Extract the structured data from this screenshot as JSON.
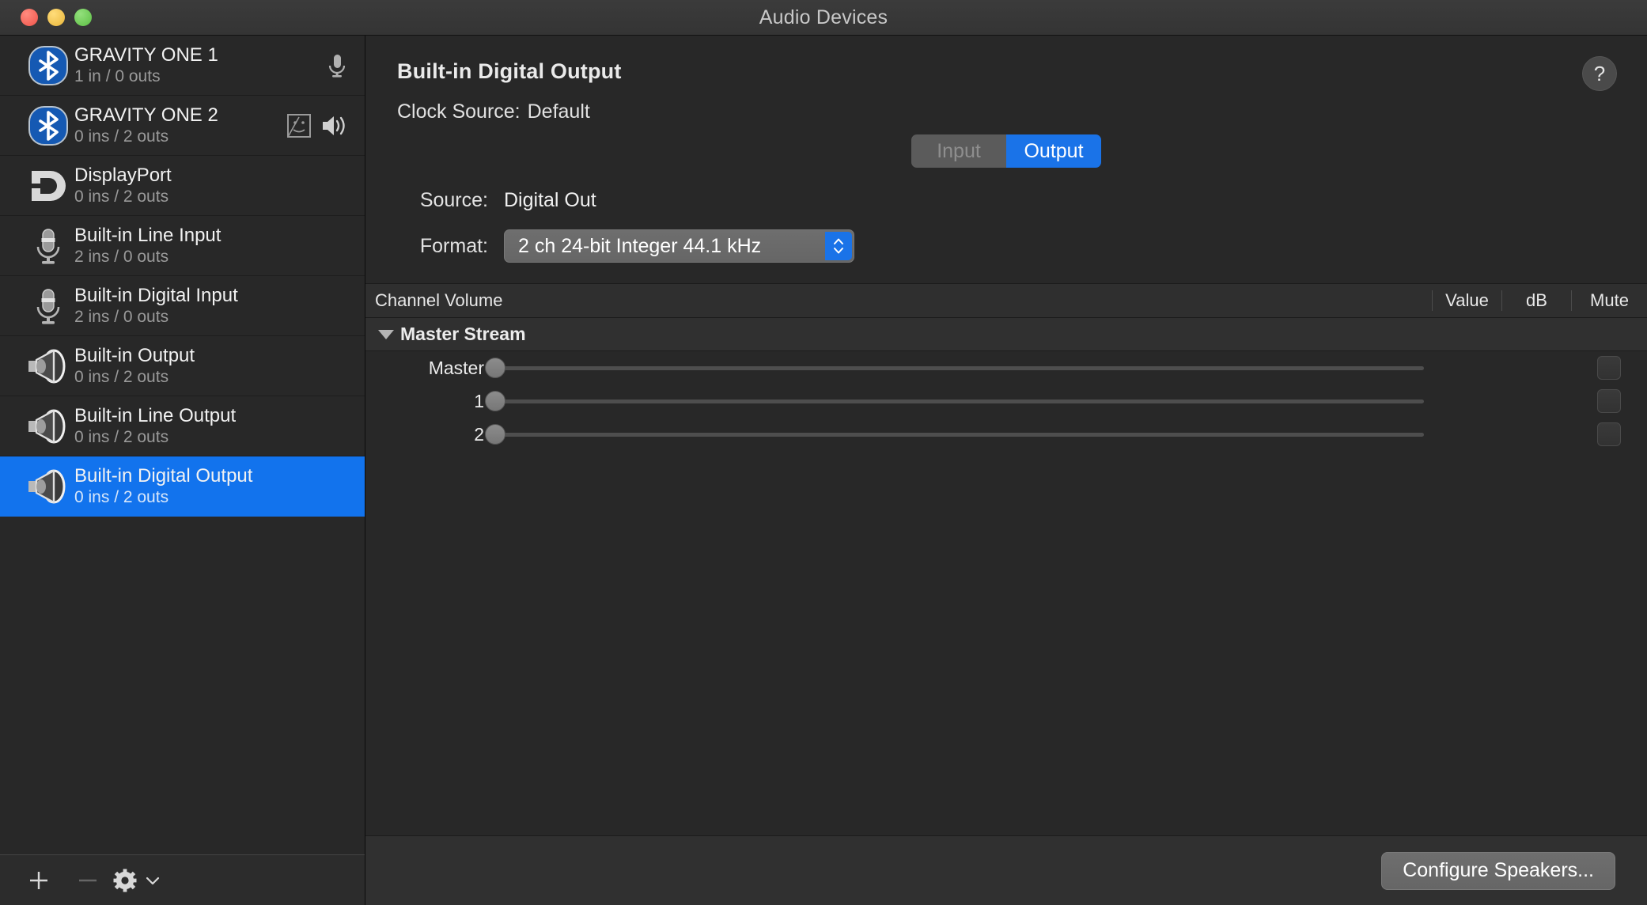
{
  "window": {
    "title": "Audio Devices",
    "traffic_lights": [
      "close-button",
      "minimize-button",
      "zoom-button"
    ]
  },
  "sidebar": {
    "devices": [
      {
        "name": "GRAVITY ONE 1",
        "channels": "1 in / 0 outs",
        "icon": "bluetooth-icon",
        "selected": false,
        "status": [
          "microphone-icon"
        ]
      },
      {
        "name": "GRAVITY ONE 2",
        "channels": "0 ins / 2 outs",
        "icon": "bluetooth-icon",
        "selected": false,
        "status": [
          "system-sound-icon",
          "speaker-icon"
        ]
      },
      {
        "name": "DisplayPort",
        "channels": "0 ins / 2 outs",
        "icon": "displayport-icon",
        "selected": false,
        "status": []
      },
      {
        "name": "Built-in Line Input",
        "channels": "2 ins / 0 outs",
        "icon": "microphone-icon",
        "selected": false,
        "status": []
      },
      {
        "name": "Built-in Digital Input",
        "channels": "2 ins / 0 outs",
        "icon": "microphone-icon",
        "selected": false,
        "status": []
      },
      {
        "name": "Built-in Output",
        "channels": "0 ins / 2 outs",
        "icon": "speaker-icon",
        "selected": false,
        "status": []
      },
      {
        "name": "Built-in Line Output",
        "channels": "0 ins / 2 outs",
        "icon": "speaker-icon",
        "selected": false,
        "status": []
      },
      {
        "name": "Built-in Digital Output",
        "channels": "0 ins / 2 outs",
        "icon": "speaker-icon",
        "selected": true,
        "status": []
      }
    ],
    "toolbar": {
      "add_label": "+",
      "remove_label": "−",
      "action_icon": "gear-icon",
      "action_chevron": "chevron-down-icon"
    },
    "selection_color": "#1273ed"
  },
  "main": {
    "device_title": "Built-in Digital Output",
    "clock_source_label": "Clock Source:",
    "clock_source_value": "Default",
    "help_label": "?",
    "tabs": [
      {
        "label": "Input",
        "active": false
      },
      {
        "label": "Output",
        "active": true
      }
    ],
    "source_label": "Source:",
    "source_value": "Digital Out",
    "format_label": "Format:",
    "format_value": "2 ch 24-bit Integer 44.1 kHz",
    "accent_color": "#1a73e8",
    "table": {
      "headers": {
        "main": "Channel Volume",
        "value": "Value",
        "db": "dB",
        "mute": "Mute"
      },
      "group": {
        "label": "Master Stream",
        "expanded": true
      },
      "rows": [
        {
          "label": "Master",
          "value": "",
          "db": "",
          "muted": false,
          "slider_pct": 0
        },
        {
          "label": "1",
          "value": "",
          "db": "",
          "muted": false,
          "slider_pct": 0
        },
        {
          "label": "2",
          "value": "",
          "db": "",
          "muted": false,
          "slider_pct": 0
        }
      ]
    },
    "footer": {
      "configure_label": "Configure Speakers..."
    }
  }
}
